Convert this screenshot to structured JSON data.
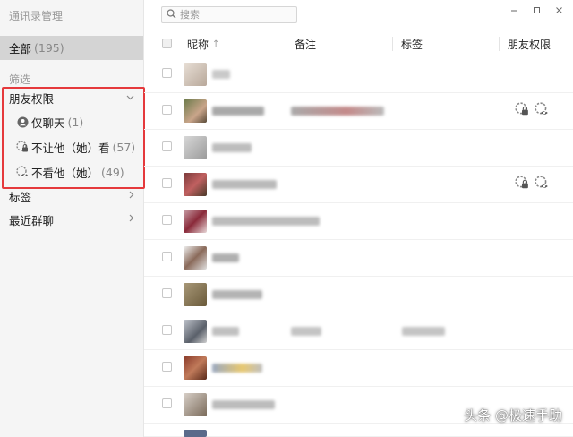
{
  "app": {
    "title": "通讯录管理"
  },
  "sidebar": {
    "all": {
      "label": "全部",
      "count": "(195)"
    },
    "filter_label": "筛选",
    "friend_permissions": {
      "label": "朋友权限",
      "items": [
        {
          "label": "仅聊天",
          "count": "(1)",
          "icon": "chat-only-icon"
        },
        {
          "label": "不让他（她）看",
          "count": "(57)",
          "icon": "lock-moments-icon"
        },
        {
          "label": "不看他（她）",
          "count": "(49)",
          "icon": "hide-moments-icon"
        }
      ]
    },
    "tags": {
      "label": "标签"
    },
    "recent_groups": {
      "label": "最近群聊"
    }
  },
  "search": {
    "placeholder": "搜索"
  },
  "table": {
    "columns": {
      "nickname": "昵称",
      "sort_arrow": "↑",
      "remark": "备注",
      "tag": "标签",
      "permissions": "朋友权限"
    }
  },
  "watermark": "头条 @极速手助",
  "colors": {
    "highlight": "#e5393c",
    "selected_bg": "#d4d4d4",
    "sidebar_bg": "#f5f5f5"
  }
}
